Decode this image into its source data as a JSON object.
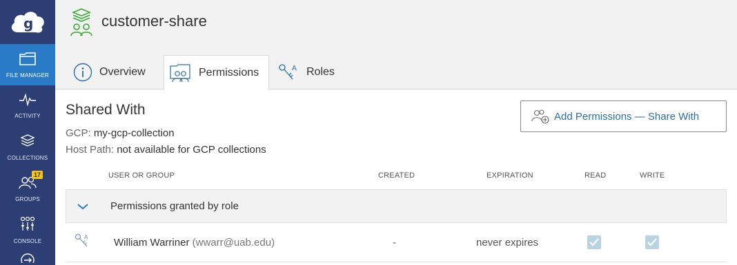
{
  "sidebar": {
    "items": [
      {
        "label": "FILE MANAGER",
        "icon": "folder-icon",
        "active": true
      },
      {
        "label": "ACTIVITY",
        "icon": "activity-icon"
      },
      {
        "label": "COLLECTIONS",
        "icon": "layers-icon"
      },
      {
        "label": "GROUPS",
        "icon": "groups-icon",
        "badge": "17"
      },
      {
        "label": "CONSOLE",
        "icon": "sliders-icon"
      }
    ]
  },
  "header": {
    "collection_name": "customer-share",
    "tabs": [
      {
        "label": "Overview",
        "icon": "info-icon"
      },
      {
        "label": "Permissions",
        "icon": "permissions-icon",
        "active": true
      },
      {
        "label": "Roles",
        "icon": "roles-icon"
      }
    ]
  },
  "main": {
    "title": "Shared With",
    "gcp_key": "GCP:",
    "gcp_value": "my-gcp-collection",
    "host_key": "Host Path:",
    "host_value": "not available for GCP collections",
    "add_button": "Add Permissions — Share With",
    "columns": {
      "user": "USER OR GROUP",
      "created": "CREATED",
      "expiration": "EXPIRATION",
      "read": "READ",
      "write": "WRITE"
    },
    "group_label": "Permissions granted by role",
    "rows": [
      {
        "name": "William Warriner",
        "email": "(wwarr@uab.edu)",
        "created": "-",
        "expiration": "never expires",
        "read": true,
        "write": true
      }
    ]
  },
  "colors": {
    "sidebar": "#2c3e73",
    "active": "#2a7bc7",
    "accent": "#2a6ea6",
    "badge": "#f5c518",
    "logo_green": "#3aaa35"
  }
}
